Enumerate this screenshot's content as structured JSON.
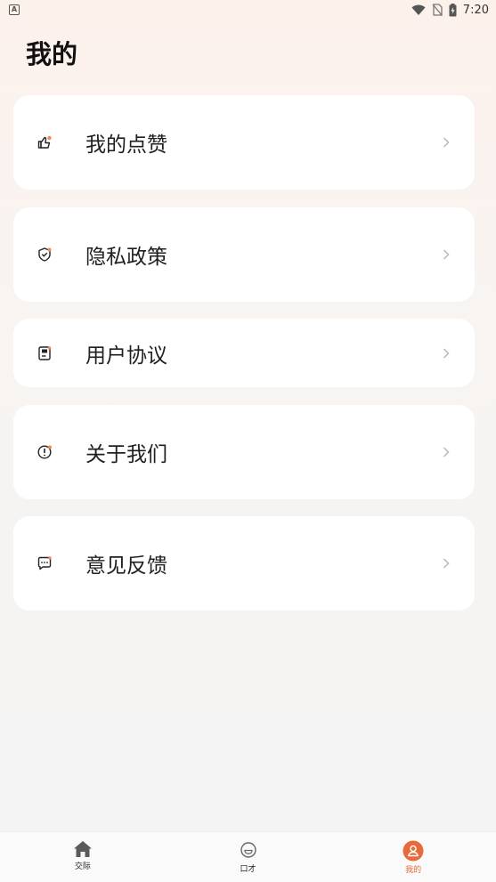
{
  "status_bar": {
    "time": "7:20",
    "app_indicator": "A"
  },
  "page": {
    "title": "我的"
  },
  "menu": [
    {
      "label": "我的点赞",
      "icon": "thumbs-up-icon"
    },
    {
      "label": "隐私政策",
      "icon": "shield-check-icon"
    },
    {
      "label": "用户协议",
      "icon": "document-icon"
    },
    {
      "label": "关于我们",
      "icon": "info-circle-icon"
    },
    {
      "label": "意见反馈",
      "icon": "chat-bubble-icon"
    }
  ],
  "tabs": [
    {
      "label": "交际",
      "icon": "home-icon",
      "active": false
    },
    {
      "label": "口才",
      "icon": "smile-face-icon",
      "active": false
    },
    {
      "label": "我的",
      "icon": "person-icon",
      "active": true
    }
  ],
  "colors": {
    "accent": "#e8693a",
    "icon_dot": "#f08a5d",
    "card": "#ffffff",
    "chevron": "#b8b8b8"
  }
}
